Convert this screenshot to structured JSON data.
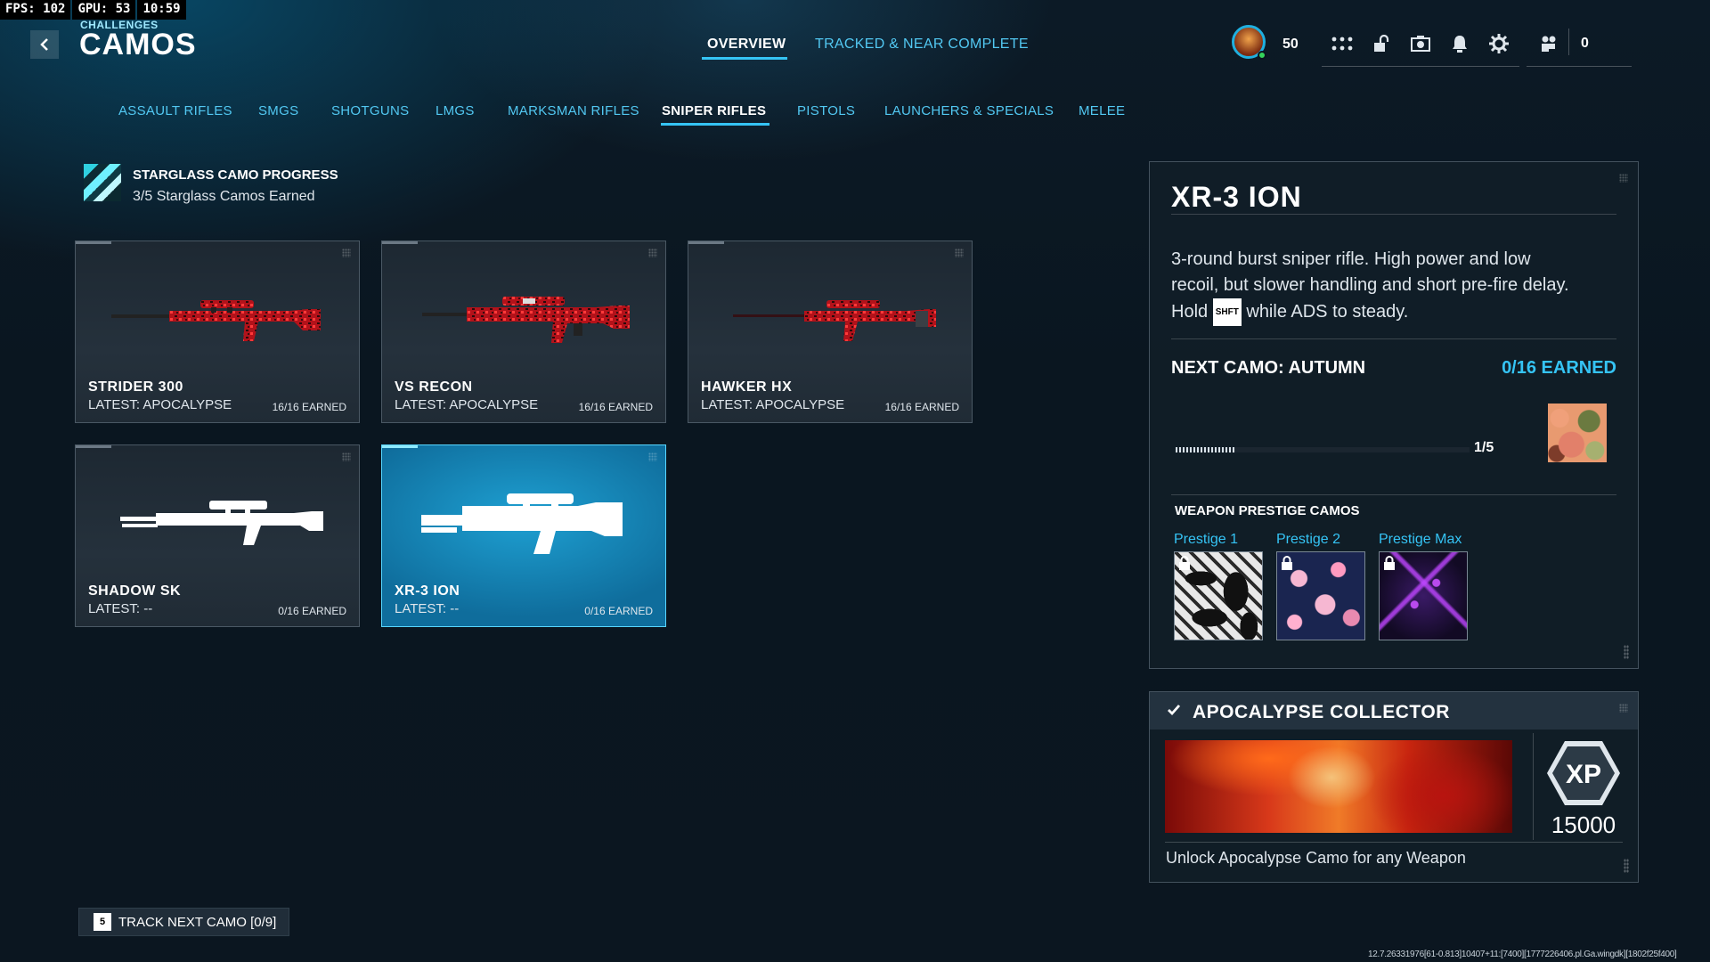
{
  "perf": {
    "fps": "FPS: 102",
    "gpu": "GPU: 53",
    "clock": "10:59"
  },
  "header": {
    "breadcrumb": "CHALLENGES",
    "title": "CAMOS"
  },
  "top_tabs": [
    {
      "label": "OVERVIEW",
      "active": true
    },
    {
      "label": "TRACKED & NEAR COMPLETE",
      "active": false
    }
  ],
  "toolbar": {
    "level": "50",
    "icons": [
      "apps-grid-icon",
      "unlock-icon",
      "camera-icon",
      "bell-icon",
      "gear-icon",
      "friends-icon"
    ],
    "friends_count": "0"
  },
  "categories": [
    {
      "label": "ASSAULT RIFLES"
    },
    {
      "label": "SMGS"
    },
    {
      "label": "SHOTGUNS"
    },
    {
      "label": "LMGS"
    },
    {
      "label": "MARKSMAN RIFLES"
    },
    {
      "label": "SNIPER RIFLES",
      "active": true
    },
    {
      "label": "PISTOLS"
    },
    {
      "label": "LAUNCHERS & SPECIALS"
    },
    {
      "label": "MELEE"
    }
  ],
  "progress_header": {
    "title": "STARGLASS CAMO PROGRESS",
    "subtitle": "3/5 Starglass Camos Earned"
  },
  "weapons": [
    {
      "name": "STRIDER 300",
      "latest": "LATEST: APOCALYPSE",
      "earned": "16/16 EARNED",
      "camo": "apocalypse"
    },
    {
      "name": "VS RECON",
      "latest": "LATEST: APOCALYPSE",
      "earned": "16/16 EARNED",
      "camo": "apocalypse"
    },
    {
      "name": "HAWKER HX",
      "latest": "LATEST: APOCALYPSE",
      "earned": "16/16 EARNED",
      "camo": "apocalypse"
    },
    {
      "name": "SHADOW SK",
      "latest": "LATEST: --",
      "earned": "0/16 EARNED",
      "camo": "none"
    },
    {
      "name": "XR-3 ION",
      "latest": "LATEST: --",
      "earned": "0/16 EARNED",
      "camo": "none",
      "selected": true
    }
  ],
  "detail": {
    "name": "XR-3 ION",
    "desc_before_key": "3-round burst sniper rifle. High power and low recoil, but slower handling and short pre-fire delay. Hold ",
    "key": "SHFT",
    "desc_after_key": " while ADS to steady.",
    "next_camo": "NEXT CAMO: AUTUMN",
    "next_earned": "0/16 EARNED",
    "progress_text": "1/5",
    "progress_fraction": 0.2,
    "prestige_title": "WEAPON PRESTIGE CAMOS",
    "prestige": [
      {
        "label": "Prestige 1",
        "locked": true
      },
      {
        "label": "Prestige 2",
        "locked": true
      },
      {
        "label": "Prestige Max",
        "locked": true
      }
    ]
  },
  "challenge": {
    "title": "APOCALYPSE COLLECTOR",
    "xp_badge": "XP",
    "xp_amount": "15000",
    "description": "Unlock Apocalypse Camo for any Weapon"
  },
  "footer": {
    "track_key": "5",
    "track_label": "TRACK NEXT CAMO [0/9]",
    "build": "12.7.26331976[61-0.813]10407+11:[7400][1777226406.pl.Ga.wingdk][1802f25f400]"
  },
  "colors": {
    "accent": "#35c4f5",
    "selected_card": "#1ea0d2",
    "apocalypse_red": "#c8141a"
  }
}
